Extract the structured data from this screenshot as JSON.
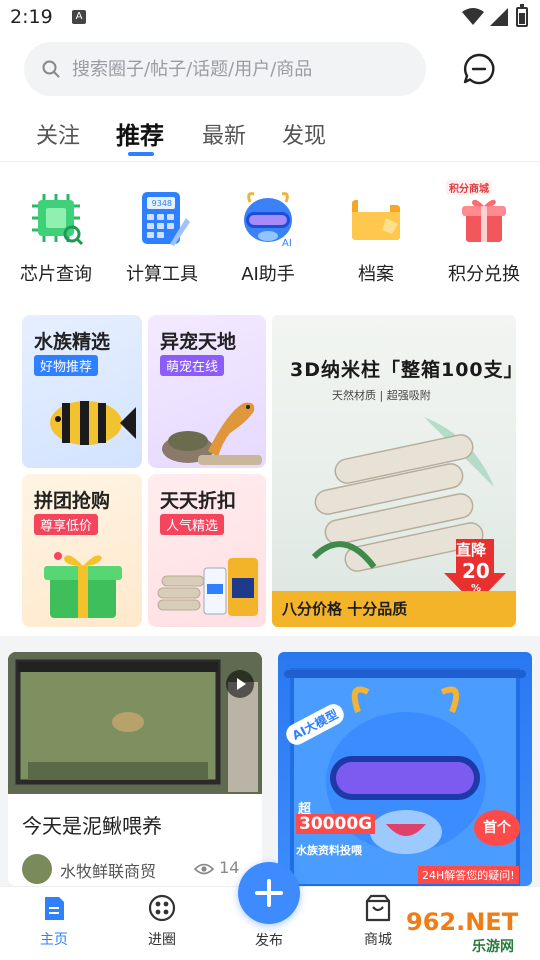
{
  "status_bar": {
    "time": "2:19",
    "notification_icon": "A"
  },
  "search": {
    "placeholder": "搜索圈子/帖子/话题/用户/商品"
  },
  "tabs": [
    {
      "label": "关注",
      "active": false
    },
    {
      "label": "推荐",
      "active": true
    },
    {
      "label": "最新",
      "active": false
    },
    {
      "label": "发现",
      "active": false
    }
  ],
  "tools": [
    {
      "label": "芯片查询",
      "icon": "chip-icon"
    },
    {
      "label": "计算工具",
      "icon": "calculator-icon"
    },
    {
      "label": "AI助手",
      "icon": "ai-assistant-icon"
    },
    {
      "label": "档案",
      "icon": "folder-icon"
    },
    {
      "label": "积分兑换",
      "icon": "points-gift-icon"
    }
  ],
  "calculator_display": "9348",
  "points_badge": "积分商城",
  "promos": [
    {
      "title": "水族精选",
      "badge": "好物推荐",
      "badge_color": "#2f80ff"
    },
    {
      "title": "异宠天地",
      "badge": "萌宠在线",
      "badge_color": "#8b5cf6"
    },
    {
      "title": "拼团抢购",
      "badge": "尊享低价",
      "badge_color": "#f5455d"
    },
    {
      "title": "天天折扣",
      "badge": "人气精选",
      "badge_color": "#f5455d"
    }
  ],
  "banner": {
    "title": "3D纳米柱「整箱100支」",
    "sub_left": "天然材质",
    "sub_right": "超强吸附",
    "discount_top": "直降",
    "discount_value": "20",
    "discount_unit": "%",
    "footer": "八分价格 十分品质"
  },
  "feed": {
    "post": {
      "title": "今天是泥鳅喂养",
      "author": "水牧鲜联商贸",
      "views": "14"
    },
    "ad": {
      "tag": "AI大模型",
      "line1": "超",
      "line2": "30000G",
      "line3": "水族资料投喂",
      "bubble": "首个",
      "footer": "24H解答您的疑问!"
    }
  },
  "bottom_nav": {
    "home": "主页",
    "circle": "进圈",
    "publish": "发布",
    "mall": "商城"
  },
  "watermark": {
    "brand": "962.NET",
    "sub": "乐游网"
  },
  "colors": {
    "accent": "#2f80ff",
    "tab_text": "#555555"
  }
}
